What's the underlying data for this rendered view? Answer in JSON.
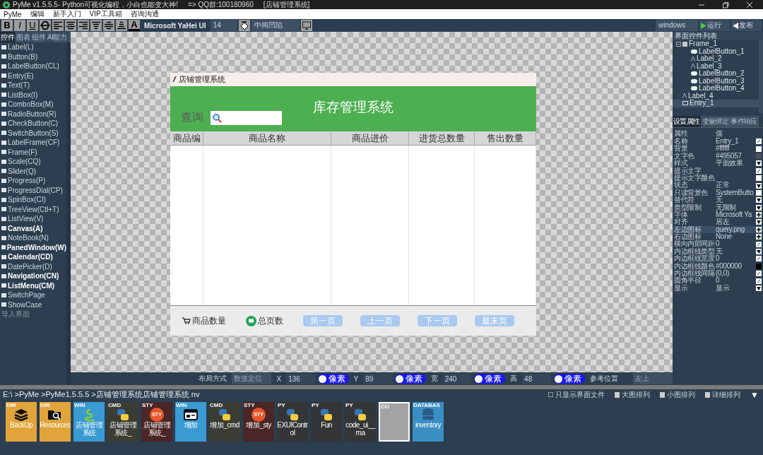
{
  "window": {
    "title": "PyMe v1.5.5.5- Python可视化编程，小白也能变大神!",
    "qq": "=> QQ群:100180960",
    "project": "[店铺管理系统]"
  },
  "menu": [
    "PyMe",
    "编辑",
    "新手入门",
    "VIP工具箱",
    "咨询沟通"
  ],
  "toolbar": {
    "tools": [
      {
        "kind": "bold",
        "label": "B"
      },
      {
        "kind": "italic",
        "label": "I"
      },
      {
        "kind": "underline",
        "label": "U"
      },
      {
        "kind": "strike"
      },
      {
        "kind": "align-left"
      },
      {
        "kind": "align-center"
      },
      {
        "kind": "align-right"
      },
      {
        "kind": "align-top"
      },
      {
        "kind": "align-middle"
      },
      {
        "kind": "align-bottom"
      },
      {
        "kind": "text-color",
        "label": "A"
      }
    ],
    "font": "Microsoft YaHei UI",
    "size": "14",
    "relief": "中间凹陷",
    "platform": "windows",
    "run": "运行",
    "publish": "发布"
  },
  "left_panel": {
    "tabs": [
      {
        "label": "控件",
        "selected": true
      },
      {
        "label": "图表",
        "selected": false
      },
      {
        "label": "组件",
        "selected": false
      },
      {
        "label": "AI能力",
        "selected": false
      }
    ],
    "items": [
      {
        "label": "Label(L)",
        "bold": false
      },
      {
        "label": "Button(B)",
        "bold": false
      },
      {
        "label": "LabelButton(CL)",
        "bold": false
      },
      {
        "label": "Entry(E)",
        "bold": false
      },
      {
        "label": "Text(T)",
        "bold": false
      },
      {
        "label": "ListBox(I)",
        "bold": false
      },
      {
        "label": "ComboBox(M)",
        "bold": false
      },
      {
        "label": "RadioButton(R)",
        "bold": false
      },
      {
        "label": "CheckButton(C)",
        "bold": false
      },
      {
        "label": "SwitchButton(S)",
        "bold": false
      },
      {
        "label": "LabelFrame(CF)",
        "bold": false
      },
      {
        "label": "Frame(F)",
        "bold": false
      },
      {
        "label": "Scale(CQ)",
        "bold": false
      },
      {
        "label": "Slider(Q)",
        "bold": false
      },
      {
        "label": "Progress(P)",
        "bold": false
      },
      {
        "label": "ProgressDial(CP)",
        "bold": false
      },
      {
        "label": "SpinBox(CI)",
        "bold": false
      },
      {
        "label": "TreeView(Ctl+T)",
        "bold": false
      },
      {
        "label": "ListView(V)",
        "bold": false
      },
      {
        "label": "Canvas(A)",
        "bold": true
      },
      {
        "label": "NoteBook(N)",
        "bold": false
      },
      {
        "label": "PanedWindow(W)",
        "bold": true
      },
      {
        "label": "Calendar(CD)",
        "bold": true
      },
      {
        "label": "DatePicker(D)",
        "bold": false
      },
      {
        "label": "Navigation(CN)",
        "bold": true
      },
      {
        "label": "ListMenu(CM)",
        "bold": true
      },
      {
        "label": "SwitchPage",
        "bold": false
      },
      {
        "label": "ShowCase",
        "bold": false
      }
    ],
    "import_label": "导入界面"
  },
  "form": {
    "title": "店铺管理系统",
    "header": "库存管理系统",
    "search_label": "查询",
    "columns": [
      "商品编",
      "商品名称",
      "商品进价",
      "进货总数量",
      "售出数量"
    ],
    "count_label": "商品数量",
    "pages_label": "总页数",
    "buttons": [
      "第一页",
      "上一页",
      "下一页",
      "最末页"
    ]
  },
  "right_panel": {
    "tree_title": "界面控件列表",
    "tree": [
      {
        "label": "Frame_1",
        "kind": "frame",
        "expanded": true,
        "selected": false,
        "children": [
          {
            "label": "LabelButton_1",
            "kind": "labelbutton",
            "selected": false
          },
          {
            "label": "Label_2",
            "kind": "label",
            "selected": false
          },
          {
            "label": "Label_3",
            "kind": "label",
            "selected": false
          },
          {
            "label": "LabelButton_2",
            "kind": "labelbutton",
            "selected": false
          },
          {
            "label": "LabelButton_3",
            "kind": "labelbutton",
            "selected": false
          },
          {
            "label": "LabelButton_4",
            "kind": "labelbutton",
            "selected": false
          }
        ]
      },
      {
        "label": "Label_4",
        "kind": "label",
        "selected": false
      },
      {
        "label": "Entry_1",
        "kind": "entry",
        "selected": true
      }
    ],
    "tabs": [
      {
        "label": "设置属性",
        "selected": true
      },
      {
        "label": "变量绑定",
        "selected": false
      },
      {
        "label": "事件响应",
        "selected": false
      }
    ],
    "header": [
      "属性",
      "值"
    ],
    "properties": [
      {
        "name": "名称",
        "value": "Entry_1",
        "kind": "edit",
        "selected": false
      },
      {
        "name": "背景",
        "value": "#ffffff",
        "kind": "swatch",
        "color": "#ffffff",
        "selected": false
      },
      {
        "name": "文字色",
        "value": "#495057",
        "kind": "swatch",
        "color": "#495057",
        "selected": false
      },
      {
        "name": "样式",
        "value": "平面效果",
        "kind": "select",
        "selected": false
      },
      {
        "name": "提示文字",
        "kind": "edit",
        "selected": false
      },
      {
        "name": "提示文字颜色",
        "kind": "swatch",
        "color": "#ffffff",
        "selected": false
      },
      {
        "name": "状态",
        "value": "正常",
        "kind": "select",
        "selected": false
      },
      {
        "name": "只读背景色",
        "value": "SystemButto",
        "kind": "swatch",
        "color": "#ffffff",
        "selected": false
      },
      {
        "name": "替代符",
        "value": "无",
        "kind": "select",
        "selected": false
      },
      {
        "name": "类型限制",
        "value": "无限制",
        "kind": "select",
        "selected": false
      },
      {
        "name": "字体",
        "value": "Microsoft Ya",
        "kind": "add",
        "selected": false
      },
      {
        "name": "对齐",
        "value": "居左",
        "kind": "select",
        "selected": false
      },
      {
        "name": "左边图标",
        "value": "query.png",
        "kind": "add",
        "selected": true
      },
      {
        "name": "右边图标",
        "value": "None",
        "kind": "add",
        "selected": false
      },
      {
        "name": "横向内部间距",
        "value": "0",
        "kind": "edit",
        "selected": false
      },
      {
        "name": "内边框线类型",
        "value": "无",
        "kind": "select",
        "selected": false
      },
      {
        "name": "内边框线宽度",
        "value": "0",
        "kind": "edit",
        "selected": false
      },
      {
        "name": "内边框线颜色",
        "value": "#000000",
        "kind": "swatch",
        "color": "#000000",
        "selected": false
      },
      {
        "name": "内边框线间隔",
        "value": "(0,0)",
        "kind": "edit",
        "selected": false
      },
      {
        "name": "圆角半径",
        "value": "0",
        "kind": "edit",
        "selected": false
      },
      {
        "name": "显示",
        "value": "显示",
        "kind": "select",
        "selected": false
      }
    ]
  },
  "layout_bar": {
    "label": "布局方式",
    "mode": "数值定位",
    "fields": [
      {
        "name": "X",
        "value": "136",
        "unit": "像素"
      },
      {
        "name": "Y",
        "value": "89",
        "unit": "像素"
      },
      {
        "name": "宽",
        "value": "240",
        "unit": "像素"
      },
      {
        "name": "高",
        "value": "48",
        "unit": "像素"
      }
    ],
    "anchor_label": "参考位置",
    "anchor": "左上"
  },
  "file_browser": {
    "path": "E:\\ >PyMe >PyMe1.5.5.5 >店铺管理系统店铺管理系统 nv",
    "filter": {
      "label": "只显示界面文件",
      "checked": false
    },
    "views": [
      "大图排列",
      "小图排列",
      "详细排列"
    ],
    "menu": "▼",
    "files": [
      {
        "tag": "DIR",
        "label": "BackUp",
        "kind": "layers",
        "color": "#e0a43a"
      },
      {
        "tag": "DIR",
        "label": "Resources",
        "kind": "folder-search",
        "color": "#e0a43a"
      },
      {
        "tag": "WIN",
        "label": "店铺管理系统",
        "kind": "snake",
        "color": "#3a9ad2"
      },
      {
        "tag": "CMD",
        "label": "店铺管理系统_",
        "kind": "code",
        "color": "#3b3c33"
      },
      {
        "tag": "STY",
        "label": "店铺管理系统_",
        "kind": "style",
        "mark": "STY",
        "color": "#4a2626"
      },
      {
        "tag": "WIN",
        "label": "增加",
        "kind": "window",
        "color": "#3a9ad2"
      },
      {
        "tag": "CMD",
        "label": "增加_cmd",
        "kind": "code",
        "color": "#3b3c33"
      },
      {
        "tag": "STY",
        "label": "增加_sty",
        "kind": "style",
        "mark": "STY",
        "color": "#4a2626"
      },
      {
        "tag": "PY",
        "label": "EXUIControl",
        "kind": "code",
        "color": "#343536"
      },
      {
        "tag": "PY",
        "label": "Fun",
        "kind": "code",
        "color": "#343536"
      },
      {
        "tag": "PY",
        "label": "code_ui__ma",
        "kind": "code",
        "color": "#343536"
      },
      {
        "tag": "CO",
        "kind": "blank",
        "color": "#a3a3a3"
      },
      {
        "tag": "DATABAS",
        "label": "inventory",
        "kind": "database",
        "color": "#3a8fc4"
      }
    ]
  }
}
